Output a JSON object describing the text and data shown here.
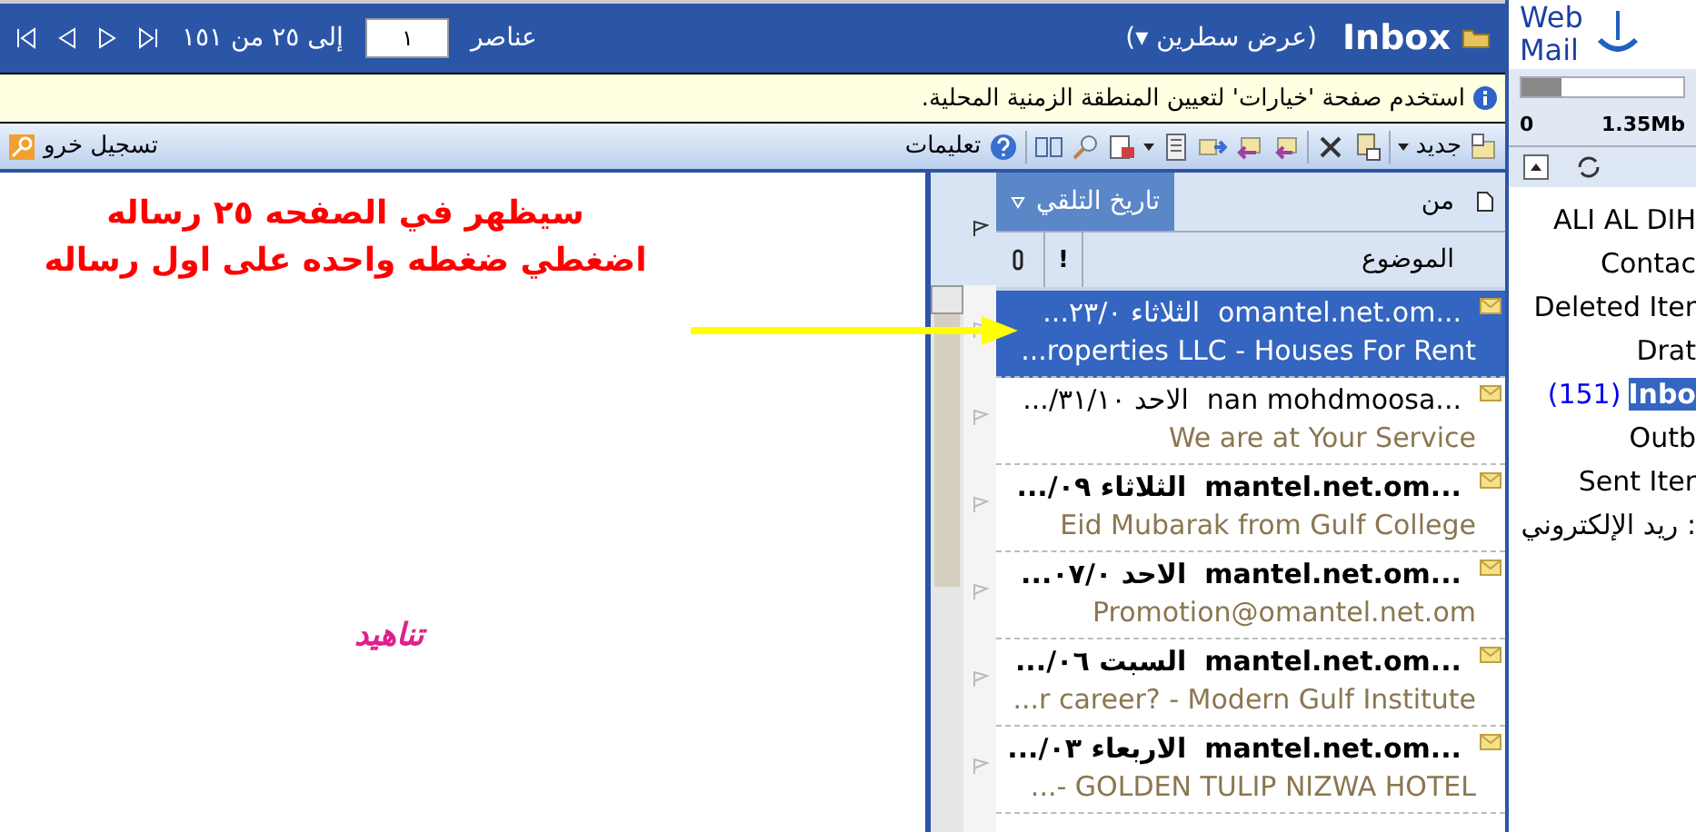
{
  "header": {
    "title": "Inbox",
    "view": "(عرض سطرين ▾)",
    "pager": {
      "items_label": "عناصر",
      "page_value": "١",
      "range": "إلى ٢٥ من ١٥١"
    }
  },
  "info_bar": {
    "text": "استخدم صفحة 'خيارات' لتعيين المنطقة الزمنية المحلية."
  },
  "toolbar": {
    "new_label": "جديد",
    "help_label": "تعليمات",
    "logout_label": "تسجيل خرو"
  },
  "list_header": {
    "from": "من",
    "date": "تاريخ التلقي",
    "subject": "الموضوع",
    "importance": "!"
  },
  "messages": [
    {
      "from": "omantel.net.om...",
      "date": "الثلاثاء ٢٣/٠...",
      "subject": "...roperties LLC - Houses For Rent",
      "selected": true,
      "unread": false
    },
    {
      "from": "nan mohdmoosa...",
      "date": "الاحد ٣١/١٠/...",
      "subject": "We are at Your Service",
      "selected": false,
      "unread": false
    },
    {
      "from": "mantel.net.om...",
      "date": "الثلاثاء ٠٩/...",
      "subject": "Eid Mubarak from Gulf College",
      "selected": false,
      "unread": true
    },
    {
      "from": "mantel.net.om...",
      "date": "الاحد ٠٧/٠...",
      "subject": "Promotion@omantel.net.om",
      "selected": false,
      "unread": true
    },
    {
      "from": "mantel.net.om...",
      "date": "السبت ٠٦/...",
      "subject": "...r career? - Modern Gulf Institute",
      "selected": false,
      "unread": true
    },
    {
      "from": "mantel.net.om...",
      "date": "الاربعاء ٠٣/...",
      "subject": "...- GOLDEN TULIP NIZWA HOTEL",
      "selected": false,
      "unread": true
    }
  ],
  "annotation": {
    "lines": [
      "سيظهر في الصفحه ٢٥ رساله",
      "اضغطي ضغطه واحده على اول رساله"
    ],
    "signature": "تناهيد"
  },
  "sidebar": {
    "logo_text": [
      "Web",
      "Mail"
    ],
    "quota": {
      "level": 0.25,
      "min": "0",
      "max": "1.35Mb"
    },
    "folders": [
      {
        "name": "ALI AL DIH",
        "selected": false
      },
      {
        "name": "Contac",
        "selected": false
      },
      {
        "name": "Deleted Iter",
        "selected": false
      },
      {
        "name": "Drat",
        "selected": false
      },
      {
        "name": "Inbo",
        "count": "(151)",
        "selected": true
      },
      {
        "name": "Outb",
        "selected": false
      },
      {
        "name": "Sent Iter",
        "selected": false
      },
      {
        "name": "ريد الإلكتروني :",
        "selected": false
      }
    ]
  }
}
